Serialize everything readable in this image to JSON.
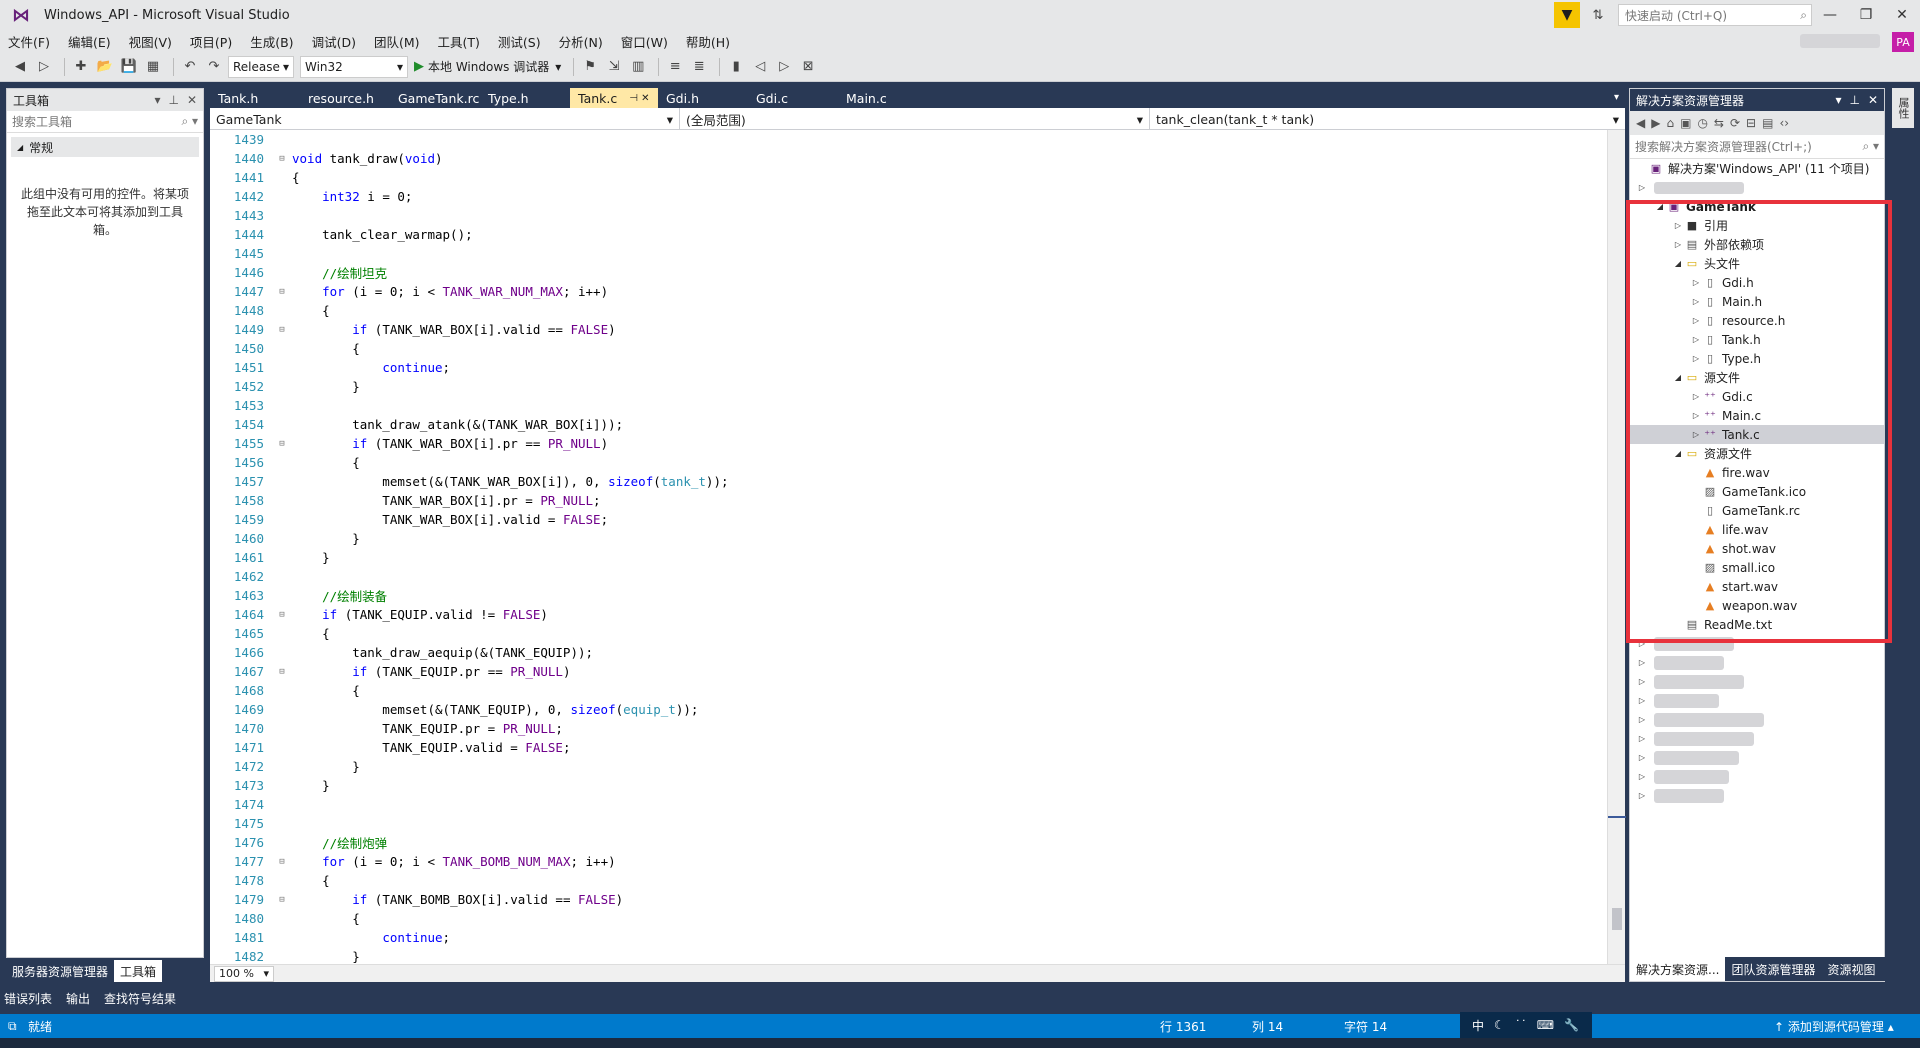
{
  "window": {
    "title": "Windows_API - Microsoft Visual Studio",
    "quick_launch_placeholder": "快速启动 (Ctrl+Q)",
    "user_initials": "PA"
  },
  "menu": [
    "文件(F)",
    "编辑(E)",
    "视图(V)",
    "项目(P)",
    "生成(B)",
    "调试(D)",
    "团队(M)",
    "工具(T)",
    "测试(S)",
    "分析(N)",
    "窗口(W)",
    "帮助(H)"
  ],
  "toolbar": {
    "configuration": "Release",
    "platform": "Win32",
    "debugger": "本地 Windows 调试器"
  },
  "toolbox": {
    "title": "工具箱",
    "search_placeholder": "搜索工具箱",
    "section": "常规",
    "empty_message": "此组中没有可用的控件。将某项拖至此文本可将其添加到工具箱。",
    "bottom_tabs": [
      "服务器资源管理器",
      "工具箱"
    ]
  },
  "editor": {
    "tabs": [
      "Tank.h",
      "resource.h",
      "GameTank.rc",
      "Type.h",
      "Tank.c",
      "Gdi.h",
      "Gdi.c",
      "Main.c"
    ],
    "active_tab": "Tank.c",
    "nav": {
      "project": "GameTank",
      "scope": "(全局范围)",
      "member": "tank_clean(tank_t * tank)"
    },
    "zoom": "100 %",
    "lines": [
      {
        "n": "1439",
        "f": "",
        "t": ""
      },
      {
        "n": "1440",
        "f": "⊟",
        "t": "void tank_draw(void)"
      },
      {
        "n": "1441",
        "f": "",
        "t": "{"
      },
      {
        "n": "1442",
        "f": "",
        "t": "    int32 i = 0;"
      },
      {
        "n": "1443",
        "f": "",
        "t": ""
      },
      {
        "n": "1444",
        "f": "",
        "t": "    tank_clear_warmap();"
      },
      {
        "n": "1445",
        "f": "",
        "t": ""
      },
      {
        "n": "1446",
        "f": "",
        "t": "    //绘制坦克"
      },
      {
        "n": "1447",
        "f": "⊟",
        "t": "    for (i = 0; i < TANK_WAR_NUM_MAX; i++)"
      },
      {
        "n": "1448",
        "f": "",
        "t": "    {"
      },
      {
        "n": "1449",
        "f": "⊟",
        "t": "        if (TANK_WAR_BOX[i].valid == FALSE)"
      },
      {
        "n": "1450",
        "f": "",
        "t": "        {"
      },
      {
        "n": "1451",
        "f": "",
        "t": "            continue;"
      },
      {
        "n": "1452",
        "f": "",
        "t": "        }"
      },
      {
        "n": "1453",
        "f": "",
        "t": ""
      },
      {
        "n": "1454",
        "f": "",
        "t": "        tank_draw_atank(&(TANK_WAR_BOX[i]));"
      },
      {
        "n": "1455",
        "f": "⊟",
        "t": "        if (TANK_WAR_BOX[i].pr == PR_NULL)"
      },
      {
        "n": "1456",
        "f": "",
        "t": "        {"
      },
      {
        "n": "1457",
        "f": "",
        "t": "            memset(&(TANK_WAR_BOX[i]), 0, sizeof(tank_t));"
      },
      {
        "n": "1458",
        "f": "",
        "t": "            TANK_WAR_BOX[i].pr = PR_NULL;"
      },
      {
        "n": "1459",
        "f": "",
        "t": "            TANK_WAR_BOX[i].valid = FALSE;"
      },
      {
        "n": "1460",
        "f": "",
        "t": "        }"
      },
      {
        "n": "1461",
        "f": "",
        "t": "    }"
      },
      {
        "n": "1462",
        "f": "",
        "t": ""
      },
      {
        "n": "1463",
        "f": "",
        "t": "    //绘制装备"
      },
      {
        "n": "1464",
        "f": "⊟",
        "t": "    if (TANK_EQUIP.valid != FALSE)"
      },
      {
        "n": "1465",
        "f": "",
        "t": "    {"
      },
      {
        "n": "1466",
        "f": "",
        "t": "        tank_draw_aequip(&(TANK_EQUIP));"
      },
      {
        "n": "1467",
        "f": "⊟",
        "t": "        if (TANK_EQUIP.pr == PR_NULL)"
      },
      {
        "n": "1468",
        "f": "",
        "t": "        {"
      },
      {
        "n": "1469",
        "f": "",
        "t": "            memset(&(TANK_EQUIP), 0, sizeof(equip_t));"
      },
      {
        "n": "1470",
        "f": "",
        "t": "            TANK_EQUIP.pr = PR_NULL;"
      },
      {
        "n": "1471",
        "f": "",
        "t": "            TANK_EQUIP.valid = FALSE;"
      },
      {
        "n": "1472",
        "f": "",
        "t": "        }"
      },
      {
        "n": "1473",
        "f": "",
        "t": "    }"
      },
      {
        "n": "1474",
        "f": "",
        "t": ""
      },
      {
        "n": "1475",
        "f": "",
        "t": ""
      },
      {
        "n": "1476",
        "f": "",
        "t": "    //绘制炮弹"
      },
      {
        "n": "1477",
        "f": "⊟",
        "t": "    for (i = 0; i < TANK_BOMB_NUM_MAX; i++)"
      },
      {
        "n": "1478",
        "f": "",
        "t": "    {"
      },
      {
        "n": "1479",
        "f": "⊟",
        "t": "        if (TANK_BOMB_BOX[i].valid == FALSE)"
      },
      {
        "n": "1480",
        "f": "",
        "t": "        {"
      },
      {
        "n": "1481",
        "f": "",
        "t": "            continue;"
      },
      {
        "n": "1482",
        "f": "",
        "t": "        }"
      }
    ]
  },
  "solution_explorer": {
    "title": "解决方案资源管理器",
    "search_placeholder": "搜索解决方案资源管理器(Ctrl+;)",
    "solution": "解决方案'Windows_API' (11 个项目)",
    "tree": [
      {
        "label": "GameTank",
        "depth": 1,
        "arrow": "◢",
        "icon": "▣",
        "bold": true
      },
      {
        "label": "引用",
        "depth": 2,
        "arrow": "▷",
        "icon": "■"
      },
      {
        "label": "外部依赖项",
        "depth": 2,
        "arrow": "▷",
        "icon": "▤"
      },
      {
        "label": "头文件",
        "depth": 2,
        "arrow": "◢",
        "icon": "▭"
      },
      {
        "label": "Gdi.h",
        "depth": 3,
        "arrow": "▷",
        "icon": "▯"
      },
      {
        "label": "Main.h",
        "depth": 3,
        "arrow": "▷",
        "icon": "▯"
      },
      {
        "label": "resource.h",
        "depth": 3,
        "arrow": "▷",
        "icon": "▯"
      },
      {
        "label": "Tank.h",
        "depth": 3,
        "arrow": "▷",
        "icon": "▯"
      },
      {
        "label": "Type.h",
        "depth": 3,
        "arrow": "▷",
        "icon": "▯"
      },
      {
        "label": "源文件",
        "depth": 2,
        "arrow": "◢",
        "icon": "▭"
      },
      {
        "label": "Gdi.c",
        "depth": 3,
        "arrow": "▷",
        "icon": "⁺⁺"
      },
      {
        "label": "Main.c",
        "depth": 3,
        "arrow": "▷",
        "icon": "⁺⁺"
      },
      {
        "label": "Tank.c",
        "depth": 3,
        "arrow": "▷",
        "icon": "⁺⁺",
        "selected": true
      },
      {
        "label": "资源文件",
        "depth": 2,
        "arrow": "◢",
        "icon": "▭"
      },
      {
        "label": "fire.wav",
        "depth": 3,
        "arrow": "",
        "icon": "▲"
      },
      {
        "label": "GameTank.ico",
        "depth": 3,
        "arrow": "",
        "icon": "▨"
      },
      {
        "label": "GameTank.rc",
        "depth": 3,
        "arrow": "",
        "icon": "▯"
      },
      {
        "label": "life.wav",
        "depth": 3,
        "arrow": "",
        "icon": "▲"
      },
      {
        "label": "shot.wav",
        "depth": 3,
        "arrow": "",
        "icon": "▲"
      },
      {
        "label": "small.ico",
        "depth": 3,
        "arrow": "",
        "icon": "▨"
      },
      {
        "label": "start.wav",
        "depth": 3,
        "arrow": "",
        "icon": "▲"
      },
      {
        "label": "weapon.wav",
        "depth": 3,
        "arrow": "",
        "icon": "▲"
      },
      {
        "label": "ReadMe.txt",
        "depth": 2,
        "arrow": "",
        "icon": "▤"
      }
    ],
    "bottom_tabs": [
      "解决方案资源...",
      "团队资源管理器",
      "资源视图"
    ]
  },
  "output_tabs": [
    "错误列表",
    "输出",
    "查找符号结果"
  ],
  "status": {
    "ready": "就绪",
    "row": "行 1361",
    "col": "列 14",
    "char": "字符 14",
    "ime": "中",
    "source_control": "添加到源代码管理"
  },
  "colors": {
    "keyword": "#0000ff",
    "comment": "#008000",
    "macro": "#6f008a",
    "type": "#2b91af",
    "accent": "#007acc",
    "highlight_box": "#e8323c"
  }
}
